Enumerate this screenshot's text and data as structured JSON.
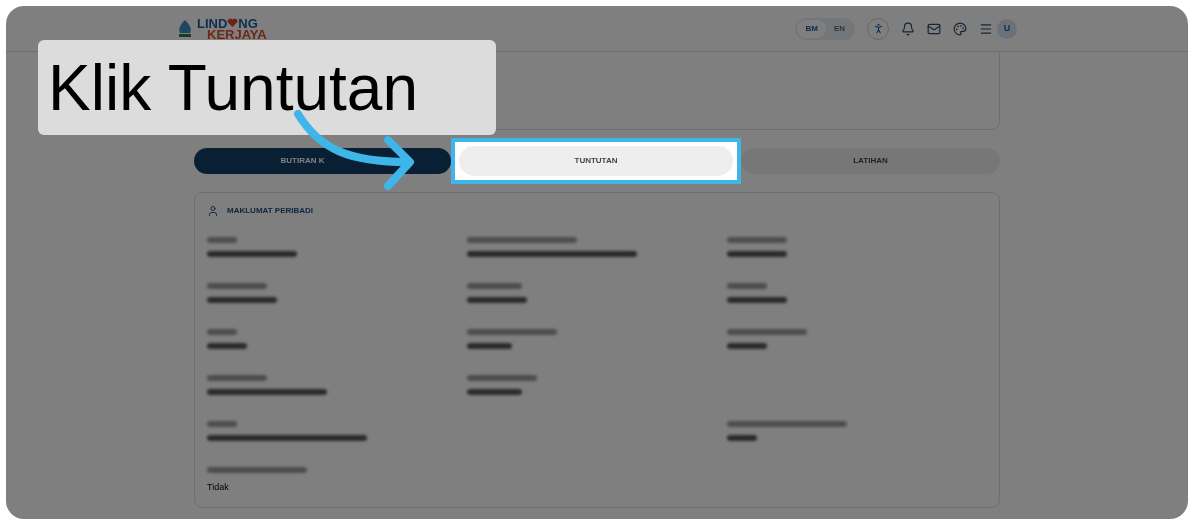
{
  "header": {
    "logo": {
      "line1_start": "LIND",
      "line1_end": "NG",
      "line2": "KERJAYA"
    },
    "languages": [
      {
        "label": "BM",
        "selected": true
      },
      {
        "label": "EN",
        "selected": false
      }
    ],
    "avatar": "U"
  },
  "tabs": [
    {
      "label": "BUTIRAN K",
      "selected": true,
      "highlighted": false
    },
    {
      "label": "TUNTUTAN",
      "selected": false,
      "highlighted": true
    },
    {
      "label": "LATIHAN",
      "selected": false,
      "highlighted": false
    }
  ],
  "section": {
    "title": "MAKLUMAT PERIBADI",
    "last_value": "Tidak"
  },
  "callout": {
    "text": "Klik Tuntutan"
  }
}
